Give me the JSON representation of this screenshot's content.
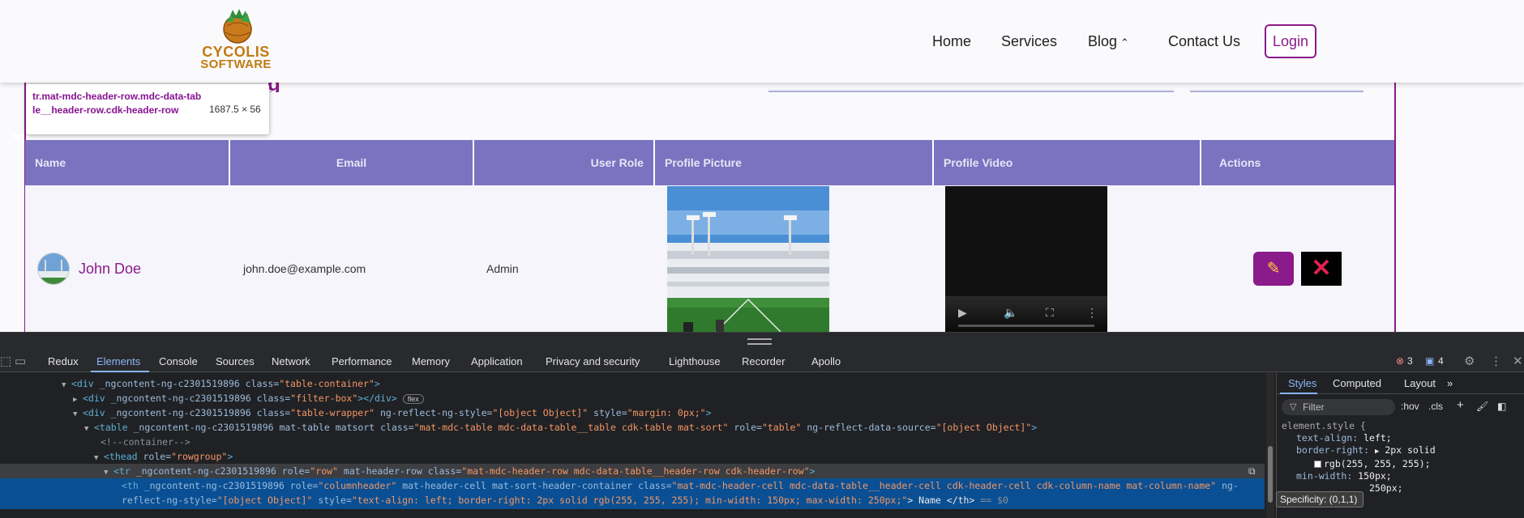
{
  "site": {
    "logo_line1": "CYCOLIS",
    "logo_line2": "SOFTWARE",
    "nav": {
      "home": "Home",
      "services": "Services",
      "blog": "Blog",
      "contact": "Contact Us",
      "login": "Login"
    },
    "title_peek": "g"
  },
  "tooltip": {
    "selector": "tr.mat-mdc-header-row.mdc-data-table__header-row.cdk-header-row",
    "size": "1687.5 × 56"
  },
  "table": {
    "headers": [
      "Name",
      "Email",
      "User Role",
      "Profile Picture",
      "Profile Video",
      "Actions"
    ],
    "row": {
      "name": "John Doe",
      "email": "john.doe@example.com",
      "role": "Admin"
    }
  },
  "devtools": {
    "tabs": [
      "Redux",
      "Elements",
      "Console",
      "Sources",
      "Network",
      "Performance",
      "Memory",
      "Application",
      "Privacy and security",
      "Lighthouse",
      "Recorder",
      "Apollo"
    ],
    "active_tab": "Elements",
    "errors": "3",
    "messages": "4",
    "dom": {
      "l1_open": "<div",
      "l1_attrs": " _ngcontent-ng-c2301519896 class=",
      "l1_val": "\"table-container\"",
      "l1_close": ">",
      "l2_open": "<div",
      "l2_attrs": " _ngcontent-ng-c2301519896 class=",
      "l2_val": "\"filter-box\"",
      "l2_mid": "></div>",
      "l2_badge": "flex",
      "l3_open": "<div",
      "l3_attr1": " _ngcontent-ng-c2301519896 class=",
      "l3_val1": "\"table-wrapper\"",
      "l3_attr2": " ng-reflect-ng-style=",
      "l3_val2": "\"[object Object]\"",
      "l3_attr3": " style=",
      "l3_val3": "\"margin: 0px;\"",
      "l3_close": ">",
      "l4_open": "<table",
      "l4_attr1": " _ngcontent-ng-c2301519896 mat-table matsort class=",
      "l4_val1": "\"mat-mdc-table mdc-data-table__table cdk-table mat-sort\"",
      "l4_attr2": " role=",
      "l4_val2": "\"table\"",
      "l4_attr3": " ng-reflect-data-source=",
      "l4_val3": "\"[object Object]\"",
      "l4_close": ">",
      "l5_comment": "<!--container-->",
      "l6_open": "<thead",
      "l6_attr": " role=",
      "l6_val": "\"rowgroup\"",
      "l6_close": ">",
      "l7_open": "<tr",
      "l7_attr1": " _ngcontent-ng-c2301519896 role=",
      "l7_val1": "\"row\"",
      "l7_attr2": " mat-header-row class=",
      "l7_val2": "\"mat-mdc-header-row mdc-data-table__header-row cdk-header-row\"",
      "l7_close": ">",
      "l8_open": "<th",
      "l8_attr1": " _ngcontent-ng-c2301519896 role=",
      "l8_val1": "\"columnheader\"",
      "l8_attr2": " mat-header-cell mat-sort-header-container class=",
      "l8_val2": "\"mat-mdc-header-cell mdc-data-table__header-cell cdk-header-cell cdk-column-name mat-column-name\"",
      "l8_attr3": " ng-reflect-ng-style=",
      "l8_val3": "\"[object Object]\"",
      "l8_attr4": " style=",
      "l8_val4": "\"text-align: left; border-right: 2px solid rgb(255, 255, 255); min-width: 150px; max-width: 250px;\"",
      "l8_text": "> Name </th>",
      "l8_eq": " == $0"
    },
    "styles": {
      "tabs": [
        "Styles",
        "Computed",
        "Layout"
      ],
      "filter_placeholder": "Filter",
      "hov": ":hov",
      "cls": ".cls",
      "selector": "element.style {",
      "p1_name": "text-align",
      "p1_val": "left;",
      "p2_name": "border-right",
      "p2_val": "2px solid",
      "p2_val_cont": "rgb(255, 255, 255);",
      "p3_name": "min-width",
      "p3_val": "150px;",
      "p4_partial": "250px;",
      "specificity": "Specificity: (0,1,1)"
    }
  }
}
